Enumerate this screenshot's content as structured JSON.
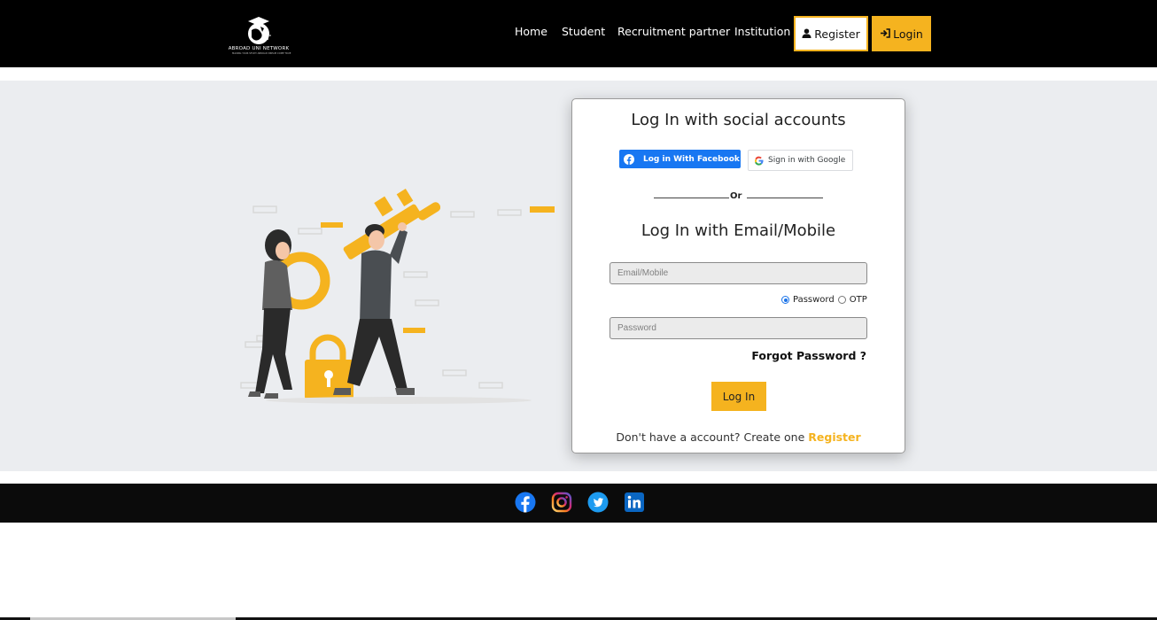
{
  "header": {
    "logo_text": "ABROAD UNI NETWORK",
    "logo_tagline": "MAKING YOUR STUDY ABROAD DREAM COME TRUE",
    "nav": [
      "Home",
      "Student",
      "Recruitment partner",
      "Institution"
    ],
    "register_label": "Register",
    "login_label": "Login"
  },
  "card": {
    "social_title": "Log In with social accounts",
    "facebook_label": "Log in With Facebook",
    "google_label": "Sign in with Google",
    "divider": "Or",
    "email_title": "Log In with Email/Mobile",
    "email_placeholder": "Email/Mobile",
    "radio_password": "Password",
    "radio_otp": "OTP",
    "password_placeholder": "Password",
    "forgot": "Forgot Password ?",
    "submit": "Log In",
    "signup_text": "Don't have a account? Create one",
    "signup_link": "Register"
  },
  "footer": {
    "social": [
      "facebook-icon",
      "instagram-icon",
      "twitter-icon",
      "linkedin-icon"
    ]
  },
  "colors": {
    "accent": "#f5b31f",
    "header_bg": "#000000",
    "main_bg": "#ebedf0",
    "facebook": "#1877f2",
    "twitter": "#1d9bf0",
    "linkedin": "#0a66c2"
  }
}
